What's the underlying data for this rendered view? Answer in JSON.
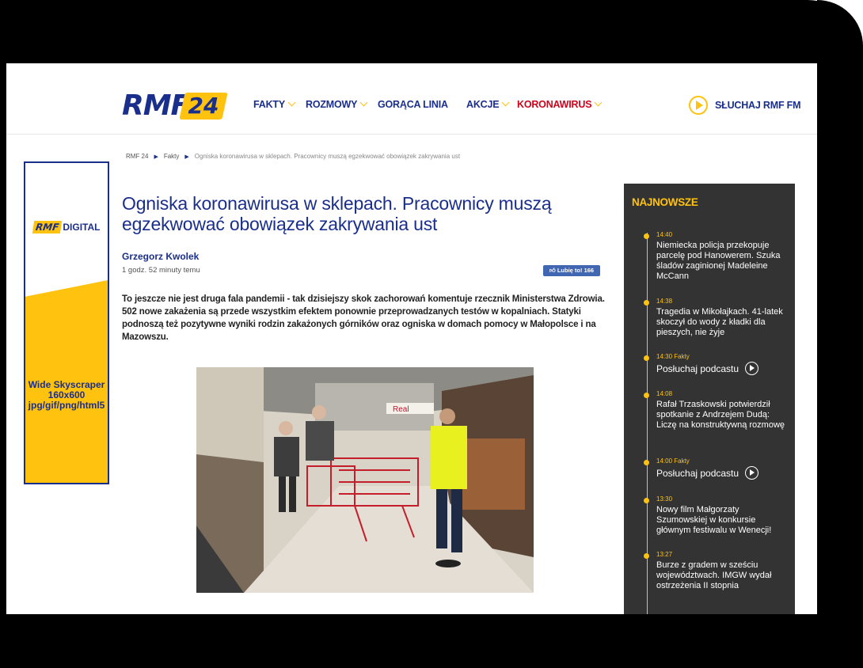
{
  "header": {
    "logo_text": "RMF",
    "logo_number": "24",
    "nav": [
      {
        "label": "FAKTY"
      },
      {
        "label": "ROZMOWY"
      },
      {
        "label": "GORĄCA LINIA"
      },
      {
        "label": "AKCJE"
      },
      {
        "label": "KORONAWIRUS"
      }
    ],
    "listen_label": "SŁUCHAJ RMF FM"
  },
  "breadcrumb": [
    "RMF 24",
    "Fakty",
    "Ogniska koronawirusa w sklepach. Pracownicy muszą egzekwować obowiązek zakrywania ust"
  ],
  "ad": {
    "logo_rmf": "RMF",
    "logo_digital": "DIGITAL",
    "text": "Wide Skyscraper 160x600 jpg/gif/png/html5"
  },
  "article": {
    "title": "Ogniska koronawirusa w sklepach. Pracownicy muszą egzekwować obowiązek zakrywania ust",
    "author": "Grzegorz Kwolek",
    "time": "1 godz. 52 minuty temu",
    "like_label": "Lubię to! 166",
    "lead": "To jeszcze nie jest druga fala pandemii - tak dzisiejszy skok zachorowań komentuje rzecznik Ministerstwa Zdrowia. 502 nowe zakażenia są przede wszystkim efektem ponownie przeprowadzanych testów w kopalniach. Statyki podnoszą też pozytywne wyniki rodzin zakażonych górników oraz ogniska w domach pomocy w Małopolsce i na Mazowszu.",
    "photo_sign": "Real"
  },
  "sidebar": {
    "title": "NAJNOWSZE",
    "items": [
      {
        "time": "14:40",
        "text": "Niemiecka policja przekopuje parcelę pod Hanowerem. Szuka śladów zaginionej Madeleine McCann"
      },
      {
        "time": "14:38",
        "text": "Tragedia w Mikołajkach. 41-latek skoczył do wody z kładki dla pieszych, nie żyje"
      },
      {
        "time": "14:30 Fakty",
        "text": "Posłuchaj podcastu"
      },
      {
        "time": "14:08",
        "text": "Rafał Trzaskowski potwierdził spotkanie z Andrzejem Dudą: Liczę na konstruktywną rozmowę"
      },
      {
        "time": "14:00 Fakty",
        "text": "Posłuchaj podcastu"
      },
      {
        "time": "13:30",
        "text": "Nowy film Małgorzaty Szumowskiej w konkursie głównym festiwalu w Wenecji!"
      },
      {
        "time": "13:27",
        "text": "Burze z gradem w sześciu województwach. IMGW wydał ostrzeżenia II stopnia"
      }
    ]
  },
  "colors": {
    "brand_blue": "#1a2e8c",
    "brand_yellow": "#ffc20e",
    "accent_red": "#d0021b",
    "sidebar_bg": "#333333"
  }
}
